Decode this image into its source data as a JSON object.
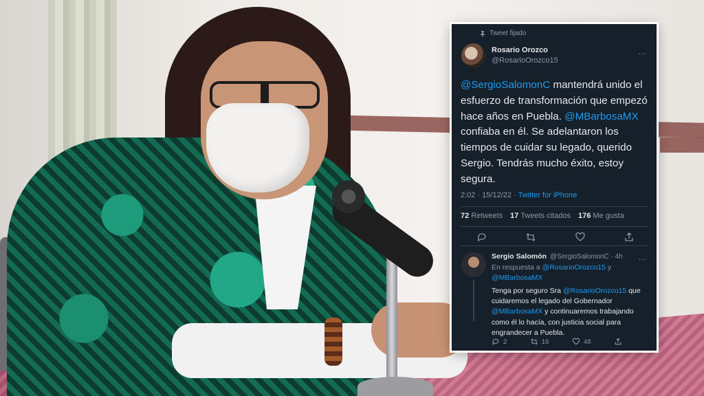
{
  "tweet": {
    "pinned_label": "Tweet fijado",
    "author_name": "Rosario Orozco",
    "author_handle": "@RosarioOrozco15",
    "more_icon": "…",
    "text_parts": {
      "m1": "@SergioSalomonC",
      "t1": " mantendrá unido el esfuerzo de transformación que empezó hace años en Puebla. ",
      "m2": "@MBarbosaMX",
      "t2": " confiaba en él. Se adelantaron los tiempos de cuidar su legado, querido Sergio. Tendrás mucho éxito, estoy segura."
    },
    "time": "2:02 · 15/12/22 · ",
    "source": "Twitter for iPhone",
    "retweets_count": "72",
    "retweets_label": "Retweets",
    "quotes_count": "17",
    "quotes_label": "Tweets citados",
    "likes_count": "176",
    "likes_label": "Me gusta",
    "actions": [
      "reply-icon",
      "retweet-icon",
      "like-icon",
      "share-icon"
    ]
  },
  "reply": {
    "author_name": "Sergio Salomón",
    "author_handle": "@SergioSalomonC · 4h",
    "in_reply_prefix": "En respuesta a ",
    "in_reply_m1": "@RosarioOrozco15",
    "in_reply_and": " y ",
    "in_reply_m2": "@MBarbosaMX",
    "body_t1": "Tenga por seguro Sra ",
    "body_m1": "@RosarioOrozco15",
    "body_t2": " que cuidaremos el legado del Gobernador ",
    "body_m2": "@MBarbosaMX",
    "body_t3": " y continuaremos trabajando como él lo hacía, con justicia social para engrandecer a Puebla.",
    "reply_count": "2",
    "retweet_count": "16",
    "like_count": "48"
  },
  "colors": {
    "card_bg": "#15202b",
    "mention": "#1d9bf0",
    "muted": "#8b98a5"
  }
}
